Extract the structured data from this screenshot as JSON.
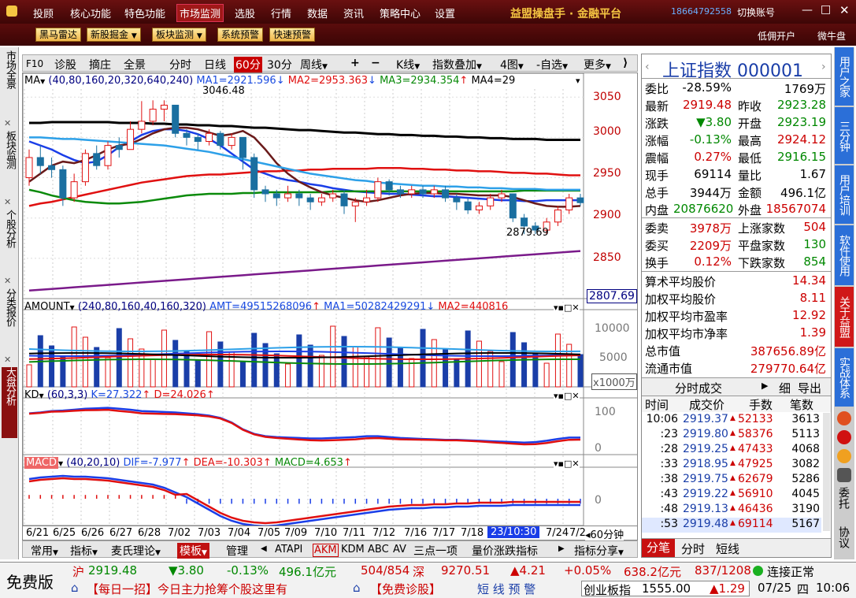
{
  "menu": {
    "items": [
      "投顾",
      "核心功能",
      "特色功能",
      "市场监测",
      "选股",
      "行情",
      "数据",
      "资讯",
      "策略中心",
      "设置"
    ],
    "active": "市场监测",
    "brand": "益盟操盘手 · 金融平台",
    "phone": "18664792558",
    "switch_account": "切换账号"
  },
  "toolbar": {
    "buttons": [
      "黑马雷达",
      "新股掘金",
      "板块监测",
      "系统预警",
      "快速预警"
    ],
    "right_links": [
      "低佣开户",
      "微牛盘"
    ]
  },
  "left_tabs": [
    "市场全景",
    "板块监测",
    "个股分析",
    "分类报价",
    "大盘分析"
  ],
  "chart_toolbar": {
    "items": [
      "F10",
      "诊股",
      "摘庄",
      "全景",
      "分时",
      "日线",
      "60分",
      "30分",
      "周线",
      "+",
      "−",
      "K线",
      "指数叠加",
      "4图",
      "自选",
      "更多"
    ],
    "active": "60分"
  },
  "ma_legend": {
    "label": "MA",
    "params": "(40,80,160,20,320,640,240)",
    "ma1": "MA1=2921.596",
    "ma2": "MA2=2953.363",
    "ma3": "MA3=2934.354",
    "ma4": "MA4=29"
  },
  "amount_legend": {
    "label": "AMOUNT",
    "params": "(240,80,160,40,160,320)",
    "amt": "AMT=49515268096",
    "ma1": "MA1=50282429291",
    "ma2": "MA2=440816"
  },
  "kd_legend": {
    "label": "KD",
    "params": "(60,3,3)",
    "k": "K=27.322",
    "d": "D=24.026"
  },
  "macd_legend": {
    "label": "MACD",
    "params": "(40,20,10)",
    "dif": "DIF=-7.977",
    "dea": "DEA=-10.303",
    "macd": "MACD=4.653"
  },
  "chart_data": {
    "type": "line",
    "price_axis_ticks": [
      "3050",
      "3000",
      "2950",
      "2900",
      "2850"
    ],
    "price_ylim": [
      2800,
      3060
    ],
    "current_price_label": "2807.69",
    "high_annotation": "3046.48",
    "low_annotation": "2879.69",
    "amount_axis_ticks": [
      "10000",
      "5000"
    ],
    "amount_unit": "x1000万",
    "kd_axis_ticks": [
      "100",
      "0"
    ],
    "macd_axis_ticks": [
      "0"
    ],
    "date_ticks": [
      "6/21",
      "6/25",
      "6/26",
      "6/27",
      "6/28",
      "7/02",
      "7/03",
      "7/04",
      "7/05",
      "7/09",
      "7/10",
      "7/11",
      "7/12",
      "7/16",
      "7/17",
      "7/18",
      "7/24",
      "7/2"
    ],
    "cursor_label": "23/10:30",
    "period_label": "◂60分钟",
    "candles": [
      [
        2950,
        2975,
        2985,
        2940
      ],
      [
        2975,
        2965,
        2990,
        2955
      ],
      [
        2965,
        2960,
        2975,
        2950
      ],
      [
        2960,
        2925,
        2965,
        2915
      ],
      [
        2925,
        2945,
        2955,
        2920
      ],
      [
        2945,
        2980,
        2985,
        2940
      ],
      [
        2980,
        2965,
        2990,
        2960
      ],
      [
        2965,
        2990,
        2995,
        2960
      ],
      [
        2990,
        2985,
        3000,
        2975
      ],
      [
        2985,
        3010,
        3020,
        2985
      ],
      [
        3010,
        3020,
        3045,
        3005
      ],
      [
        3020,
        3035,
        3046,
        3015
      ],
      [
        3035,
        3040,
        3046,
        3020
      ],
      [
        3040,
        3005,
        3040,
        3000
      ],
      [
        3005,
        3000,
        3010,
        2990
      ],
      [
        3000,
        2995,
        3005,
        2985
      ],
      [
        2995,
        3005,
        3010,
        2990
      ],
      [
        3005,
        2990,
        3008,
        2985
      ],
      [
        2990,
        3000,
        3005,
        2985
      ],
      [
        3000,
        2975,
        3000,
        2960
      ],
      [
        2975,
        2935,
        2980,
        2925
      ],
      [
        2935,
        2930,
        2940,
        2920
      ],
      [
        2930,
        2925,
        2935,
        2915
      ],
      [
        2925,
        2930,
        2940,
        2920
      ],
      [
        2930,
        2925,
        2935,
        2915
      ],
      [
        2925,
        2920,
        2930,
        2910
      ],
      [
        2920,
        2925,
        2930,
        2915
      ],
      [
        2925,
        2930,
        2935,
        2920
      ],
      [
        2930,
        2915,
        2935,
        2905
      ],
      [
        2915,
        2920,
        2925,
        2895
      ],
      [
        2920,
        2925,
        2935,
        2915
      ],
      [
        2925,
        2945,
        2950,
        2920
      ],
      [
        2945,
        2935,
        2948,
        2928
      ],
      [
        2935,
        2930,
        2940,
        2925
      ],
      [
        2930,
        2935,
        2940,
        2925
      ],
      [
        2935,
        2930,
        2940,
        2925
      ],
      [
        2930,
        2935,
        2940,
        2925
      ],
      [
        2935,
        2925,
        2940,
        2920
      ],
      [
        2925,
        2920,
        2930,
        2910
      ],
      [
        2920,
        2910,
        2925,
        2905
      ],
      [
        2910,
        2915,
        2920,
        2905
      ],
      [
        2915,
        2925,
        2930,
        2910
      ],
      [
        2925,
        2930,
        2935,
        2920
      ],
      [
        2930,
        2900,
        2930,
        2895
      ],
      [
        2900,
        2890,
        2905,
        2880
      ],
      [
        2890,
        2885,
        2895,
        2880
      ],
      [
        2885,
        2895,
        2900,
        2880
      ],
      [
        2895,
        2910,
        2915,
        2890
      ],
      [
        2910,
        2925,
        2930,
        2905
      ],
      [
        2925,
        2919,
        2930,
        2915
      ]
    ],
    "series": [
      {
        "name": "MA1",
        "color": "#1a3ee8",
        "values": [
          2995,
          2990,
          2985,
          2978,
          2972,
          2968,
          2970,
          2978,
          2988,
          2995,
          3003,
          3008,
          3010,
          3010,
          3008,
          3004,
          2998,
          2990,
          2980,
          2970,
          2960,
          2955,
          2950,
          2947,
          2945,
          2942,
          2940,
          2937,
          2935,
          2933,
          2932,
          2931,
          2930,
          2930,
          2929,
          2928,
          2927,
          2927,
          2926,
          2925,
          2924,
          2923,
          2922,
          2922,
          2921,
          2921,
          2922,
          2922,
          2922,
          2922
        ]
      },
      {
        "name": "MA2",
        "color": "#e01010",
        "values": [
          2915,
          2918,
          2920,
          2923,
          2926,
          2929,
          2932,
          2935,
          2938,
          2941,
          2944,
          2946,
          2948,
          2950,
          2952,
          2953,
          2954,
          2954,
          2955,
          2956,
          2957,
          2958,
          2958,
          2959,
          2959,
          2960,
          2960,
          2961,
          2961,
          2961,
          2961,
          2962,
          2962,
          2962,
          2961,
          2961,
          2960,
          2960,
          2959,
          2959,
          2958,
          2958,
          2957,
          2956,
          2956,
          2955,
          2955,
          2954,
          2953,
          2953
        ]
      },
      {
        "name": "MA3",
        "color": "#0a8a0a",
        "values": [
          2935,
          2932,
          2928,
          2925,
          2922,
          2920,
          2919,
          2918,
          2918,
          2919,
          2920,
          2922,
          2924,
          2926,
          2928,
          2929,
          2930,
          2930,
          2930,
          2931,
          2931,
          2932,
          2932,
          2932,
          2932,
          2932,
          2932,
          2933,
          2933,
          2933,
          2933,
          2933,
          2933,
          2933,
          2933,
          2933,
          2933,
          2933,
          2933,
          2933,
          2933,
          2933,
          2933,
          2933,
          2934,
          2934,
          2934,
          2934,
          2934,
          2934
        ]
      },
      {
        "name": "MA4",
        "color": "#000000",
        "values": [
          3018,
          3018,
          3019,
          3019,
          3019,
          3019,
          3019,
          3019,
          3018,
          3018,
          3018,
          3017,
          3017,
          3016,
          3016,
          3015,
          3015,
          3014,
          3014,
          3013,
          3012,
          3012,
          3011,
          3010,
          3009,
          3009,
          3008,
          3007,
          3006,
          3006,
          3005,
          3004,
          3004,
          3003,
          3003,
          3002,
          3002,
          3001,
          3001,
          3000,
          3000,
          2999,
          2999,
          2998,
          2998,
          2998,
          2997,
          2997,
          2997,
          2997
        ]
      },
      {
        "name": "MA5",
        "color": "#6a1a1a",
        "values": [
          2945,
          2955,
          2965,
          2970,
          2968,
          2972,
          2978,
          2985,
          2990,
          2992,
          2998,
          3005,
          3010,
          3012,
          3012,
          3010,
          3006,
          3002,
          3004,
          3008,
          3000,
          2985,
          2968,
          2955,
          2945,
          2938,
          2932,
          2928,
          2925,
          2922,
          2920,
          2922,
          2925,
          2928,
          2930,
          2931,
          2931,
          2930,
          2930,
          2929,
          2928,
          2928,
          2928,
          2926,
          2922,
          2918,
          2915,
          2914,
          2914,
          2915
        ]
      },
      {
        "name": "MA6",
        "color": "#2da0e8",
        "values": [
          3000,
          3000,
          2999,
          2998,
          2998,
          2997,
          2996,
          2995,
          2994,
          2993,
          2992,
          2991,
          2990,
          2988,
          2986,
          2984,
          2982,
          2979,
          2976,
          2973,
          2970,
          2967,
          2964,
          2961,
          2958,
          2955,
          2953,
          2951,
          2949,
          2947,
          2946,
          2944,
          2943,
          2942,
          2941,
          2940,
          2940,
          2939,
          2939,
          2938,
          2938,
          2937,
          2937,
          2936,
          2936,
          2936,
          2935,
          2935,
          2935,
          2935
        ]
      },
      {
        "name": "MA7",
        "color": "#7a1a8a",
        "values": [
          2810,
          2811,
          2812,
          2813,
          2814,
          2815,
          2816,
          2817,
          2818,
          2819,
          2820,
          2821,
          2822,
          2823,
          2824,
          2825,
          2826,
          2827,
          2828,
          2829,
          2830,
          2831,
          2832,
          2833,
          2834,
          2835,
          2836,
          2837,
          2838,
          2839,
          2840,
          2841,
          2842,
          2843,
          2844,
          2845,
          2846,
          2847,
          2848,
          2849,
          2850,
          2851,
          2852,
          2853,
          2854,
          2855,
          2856,
          2857,
          2858,
          2859
        ]
      }
    ]
  },
  "right_panel": {
    "title": "上证指数",
    "code": "000001",
    "rows": [
      [
        "委比",
        "-28.59%",
        "",
        "1769万"
      ],
      [
        "最新",
        "2919.48",
        "昨收",
        "2923.28"
      ],
      [
        "涨跌",
        "▼3.80",
        "开盘",
        "2923.19"
      ],
      [
        "涨幅",
        "-0.13%",
        "最高",
        "2924.12"
      ],
      [
        "震幅",
        "0.27%",
        "最低",
        "2916.15"
      ],
      [
        "现手",
        "69114",
        "量比",
        "1.67"
      ],
      [
        "总手",
        "3944万",
        "金额",
        "496.1亿"
      ],
      [
        "内盘",
        "20876620",
        "外盘",
        "18567074"
      ]
    ],
    "rows2": [
      [
        "委卖",
        "3978万",
        "上涨家数",
        "504"
      ],
      [
        "委买",
        "2209万",
        "平盘家数",
        "130"
      ],
      [
        "换手",
        "0.12%",
        "下跌家数",
        "854"
      ]
    ],
    "stats": [
      [
        "算术平均股价",
        "14.34"
      ],
      [
        "加权平均股价",
        "8.11"
      ],
      [
        "加权平均市盈率",
        "12.92"
      ],
      [
        "加权平均市净率",
        "1.39"
      ],
      [
        "总市值",
        "387656.89亿"
      ],
      [
        "流通市值",
        "279770.64亿"
      ]
    ],
    "trade_tabs": [
      "分时成交",
      "细",
      "导出"
    ],
    "trade_header": [
      "时间",
      "成交价",
      "手数",
      "笔数"
    ],
    "trades": [
      [
        "10:06",
        "2919.37",
        "52133",
        "3613"
      ],
      [
        ":23",
        "2919.80",
        "58376",
        "5113"
      ],
      [
        ":28",
        "2919.25",
        "47433",
        "4068"
      ],
      [
        ":33",
        "2918.95",
        "47925",
        "3082"
      ],
      [
        ":38",
        "2919.75",
        "62679",
        "5286"
      ],
      [
        ":43",
        "2919.22",
        "56910",
        "4045"
      ],
      [
        ":48",
        "2919.13",
        "46436",
        "3190"
      ],
      [
        ":53",
        "2919.48",
        "69114",
        "5167"
      ]
    ],
    "bottom_tabs": [
      "分笔",
      "分时",
      "短线"
    ]
  },
  "side_tabs": [
    "用户之家",
    "三分钟",
    "用户培训",
    "软件使用",
    "关于益盟",
    "实战体系"
  ],
  "side_icons": [
    "委托",
    "协议"
  ],
  "bottom_tabs": [
    "常用",
    "指标",
    "麦氏理论",
    "模板",
    "管理",
    "ATAPI",
    "AKM",
    "KDM",
    "ABC",
    "AV",
    "三点一项",
    "量价涨跌指标",
    "指标分享"
  ],
  "status": {
    "free": "免费版",
    "sh": [
      "沪",
      "2919.48",
      "▼3.80",
      "-0.13%",
      "496.1亿元",
      "504/854"
    ],
    "sz": [
      "深",
      "9270.51",
      "▲4.21",
      "+0.05%",
      "638.2亿元",
      "837/1208"
    ],
    "connection": "连接正常",
    "ticker1": "【每日一招】今日主力抢筹个股这里有",
    "ticker2": "【免费诊股】",
    "ticker3": "短 线 预 警",
    "gem": "创业板指",
    "gem_value": "1555.00",
    "gem_change": "▲1.29",
    "date": "07/25",
    "weekday": "四",
    "time": "10:06"
  }
}
